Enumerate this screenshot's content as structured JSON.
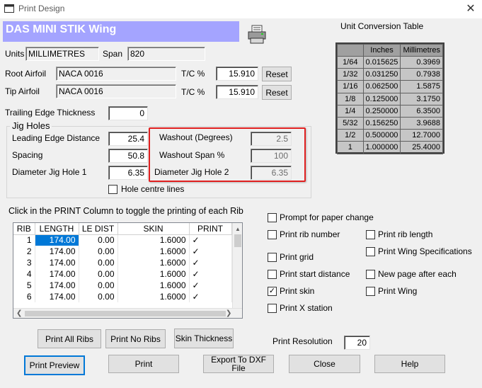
{
  "window": {
    "title": "Print Design",
    "close_glyph": "✕"
  },
  "banner": {
    "title": "DAS MINI STIK Wing"
  },
  "units": {
    "label": "Units",
    "value": "MILLIMETRES"
  },
  "span": {
    "label": "Span",
    "value": "820"
  },
  "root_airfoil": {
    "label": "Root Airfoil",
    "value": "NACA 0016",
    "tc_label": "T/C %",
    "tc_value": "15.910",
    "reset": "Reset"
  },
  "tip_airfoil": {
    "label": "Tip Airfoil",
    "value": "NACA 0016",
    "tc_label": "T/C %",
    "tc_value": "15.910",
    "reset": "Reset"
  },
  "trailing_edge": {
    "label": "Trailing Edge Thickness",
    "value": "0"
  },
  "jig": {
    "title": "Jig Holes",
    "leading_edge_label": "Leading Edge Distance",
    "leading_edge_value": "25.4",
    "spacing_label": "Spacing",
    "spacing_value": "50.8",
    "dia1_label": "Diameter Jig Hole 1",
    "dia1_value": "6.35",
    "washout_label": "Washout (Degrees)",
    "washout_value": "2.5",
    "washout_span_label": "Washout Span %",
    "washout_span_value": "100",
    "dia2_label": "Diameter Jig Hole 2",
    "dia2_value": "6.35",
    "centre_lines_label": "Hole centre lines"
  },
  "conversion": {
    "title": "Unit Conversion Table",
    "headers": [
      "",
      "Inches",
      "Millimetres"
    ],
    "rows": [
      [
        "1/64",
        "0.015625",
        "0.3969"
      ],
      [
        "1/32",
        "0.031250",
        "0.7938"
      ],
      [
        "1/16",
        "0.062500",
        "1.5875"
      ],
      [
        "1/8",
        "0.125000",
        "3.1750"
      ],
      [
        "1/4",
        "0.250000",
        "6.3500"
      ],
      [
        "5/32",
        "0.156250",
        "3.9688"
      ],
      [
        "1/2",
        "0.500000",
        "12.7000"
      ],
      [
        "1",
        "1.000000",
        "25.4000"
      ]
    ]
  },
  "ribs": {
    "instruction": "Click in the PRINT Column to toggle the printing of each Rib",
    "columns": [
      "RIB",
      "LENGTH",
      "LE DIST",
      "SKIN",
      "PRINT"
    ],
    "rows": [
      [
        "1",
        "174.00",
        "0.00",
        "1.6000",
        "✓"
      ],
      [
        "2",
        "174.00",
        "0.00",
        "1.6000",
        "✓"
      ],
      [
        "3",
        "174.00",
        "0.00",
        "1.6000",
        "✓"
      ],
      [
        "4",
        "174.00",
        "0.00",
        "1.6000",
        "✓"
      ],
      [
        "5",
        "174.00",
        "0.00",
        "1.6000",
        "✓"
      ],
      [
        "6",
        "174.00",
        "0.00",
        "1.6000",
        "✓"
      ]
    ]
  },
  "options": {
    "prompt_paper": "Prompt for paper change",
    "print_rib_number": "Print rib number",
    "print_rib_length": "Print rib length",
    "print_wing_specs": "Print  Wing Specifications",
    "print_grid": "Print grid",
    "print_start_distance": "Print start distance",
    "new_page": "New page after each",
    "print_skin": "Print skin",
    "print_wing": "Print  Wing",
    "print_x_station": "Print X station",
    "check_glyph": "✓"
  },
  "buttons": {
    "print_all_ribs": "Print All Ribs",
    "print_no_ribs": "Print No Ribs",
    "skin_thickness": "Skin Thickness",
    "print_preview": "Print Preview",
    "print": "Print",
    "export_dxf": "Export To DXF File",
    "close": "Close",
    "help": "Help"
  },
  "resolution": {
    "label": "Print Resolution",
    "value": "20"
  }
}
